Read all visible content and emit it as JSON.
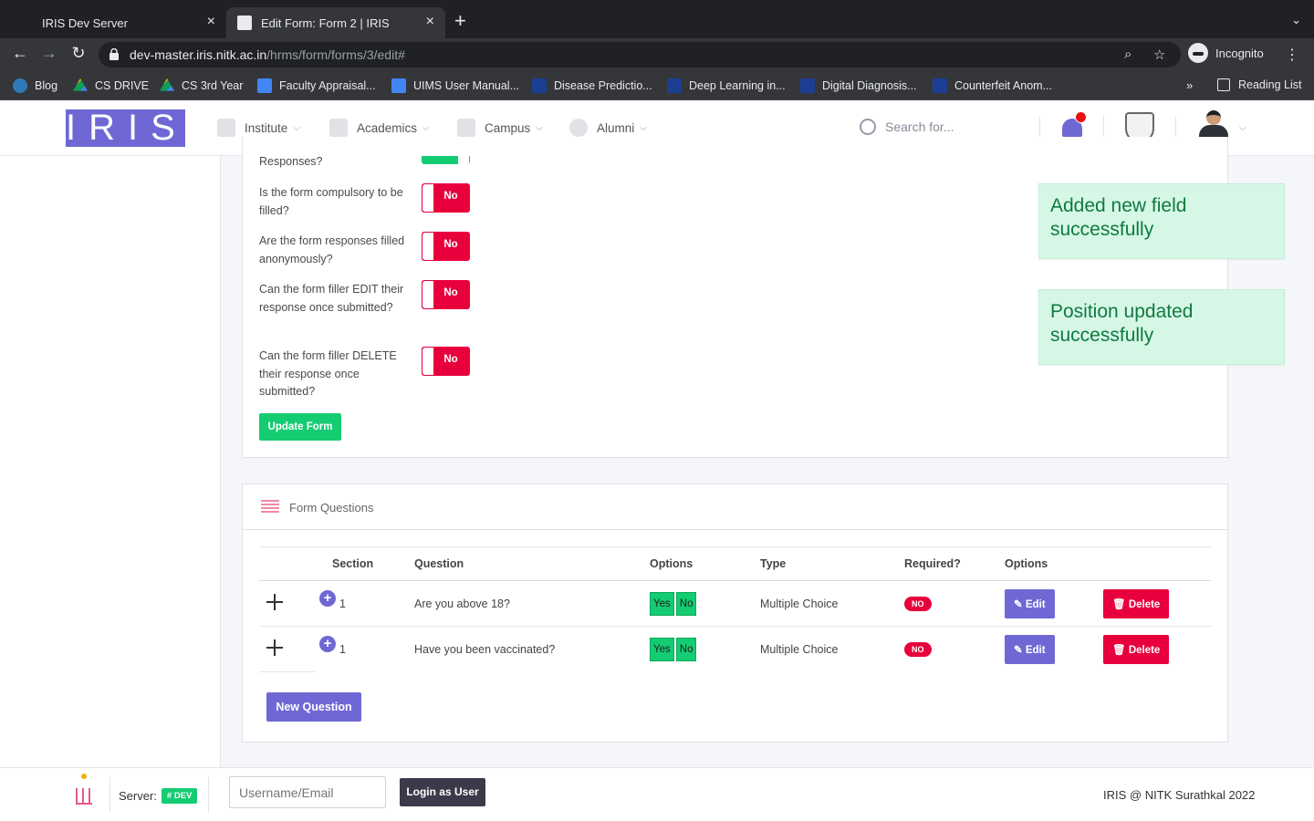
{
  "browser": {
    "tabs": [
      {
        "title": "IRIS Dev Server",
        "active": false
      },
      {
        "title": "Edit Form: Form 2 | IRIS",
        "active": true
      }
    ],
    "url_host": "dev-master.iris.nitk.ac.in",
    "url_path": "/hrms/form/forms/3/edit#",
    "profile_label": "Incognito",
    "bookmarks": [
      {
        "label": "Blog",
        "icon": "wordpress-icon"
      },
      {
        "label": "CS DRIVE",
        "icon": "google-drive-icon"
      },
      {
        "label": "CS 3rd Year",
        "icon": "google-drive-icon"
      },
      {
        "label": "Faculty Appraisal...",
        "icon": "google-docs-icon"
      },
      {
        "label": "UIMS User Manual...",
        "icon": "google-docs-icon"
      },
      {
        "label": "Disease Predictio...",
        "icon": "ieee-icon"
      },
      {
        "label": "Deep Learning in...",
        "icon": "ieee-icon"
      },
      {
        "label": "Digital Diagnosis...",
        "icon": "ieee-icon"
      },
      {
        "label": "Counterfeit Anom...",
        "icon": "ieee-icon"
      }
    ],
    "bookmarks_more": "»",
    "reading_list": "Reading List"
  },
  "app": {
    "logo": "IRIS",
    "nav": [
      "Institute",
      "Academics",
      "Campus",
      "Alumni"
    ],
    "search_placeholder": "Search for...",
    "accent": "#6f68d4"
  },
  "settings": {
    "partial_label": "Responses?",
    "rows": [
      {
        "label": "Is the form compulsory to be filled?",
        "value": "No"
      },
      {
        "label": "Are the form responses filled anonymously?",
        "value": "No"
      },
      {
        "label": "Can the form filler EDIT their response once submitted?",
        "value": "No"
      },
      {
        "label": "Can the form filler DELETE their response once submitted?",
        "value": "No"
      }
    ],
    "update_button": "Update Form"
  },
  "toasts": [
    "Added new field successfully",
    "Position updated successfully"
  ],
  "questions": {
    "title": "Form Questions",
    "columns": [
      "Section",
      "Question",
      "Options",
      "Type",
      "Required?",
      "Options"
    ],
    "rows": [
      {
        "section": "1",
        "question": "Are you above 18?",
        "options": [
          "Yes",
          "No"
        ],
        "type": "Multiple Choice",
        "required": "NO",
        "edit": "Edit",
        "delete": "Delete"
      },
      {
        "section": "1",
        "question": "Have you been vaccinated?",
        "options": [
          "Yes",
          "No"
        ],
        "type": "Multiple Choice",
        "required": "NO",
        "edit": "Edit",
        "delete": "Delete"
      }
    ],
    "new_button": "New Question"
  },
  "footer": {
    "server_label": "Server:",
    "server_badge": "# DEV",
    "username_placeholder": "Username/Email",
    "login_button": "Login as User",
    "copyright": "IRIS @ NITK Surathkal 2022"
  }
}
